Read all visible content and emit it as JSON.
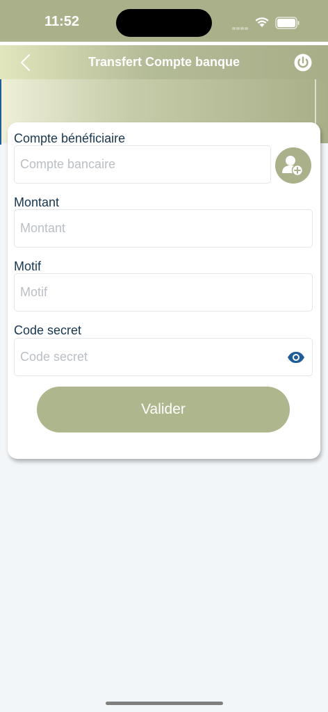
{
  "status_bar": {
    "time": "11:52",
    "background_color": "#a9b08a",
    "icons": [
      "cellular-signal-icon",
      "wifi-icon",
      "battery-icon"
    ]
  },
  "header": {
    "title": "Transfert Compte banque",
    "back_icon": "chevron-left-icon",
    "power_icon": "power-icon"
  },
  "form": {
    "beneficiary": {
      "label": "Compte bénéficiaire",
      "placeholder": "Compte bancaire",
      "value": "",
      "add_contact_icon": "add-contact-icon"
    },
    "amount": {
      "label": "Montant",
      "placeholder": "Montant",
      "value": ""
    },
    "reason": {
      "label": "Motif",
      "placeholder": "Motif",
      "value": ""
    },
    "secret_code": {
      "label": "Code secret",
      "placeholder": "Code secret",
      "value": "",
      "visibility_icon": "eye-icon"
    },
    "submit_label": "Valider"
  },
  "colors": {
    "accent": "#a9b08a",
    "label_text": "#17364f",
    "eye_icon": "#1f5d99",
    "page_background": "#f2f6f9"
  }
}
